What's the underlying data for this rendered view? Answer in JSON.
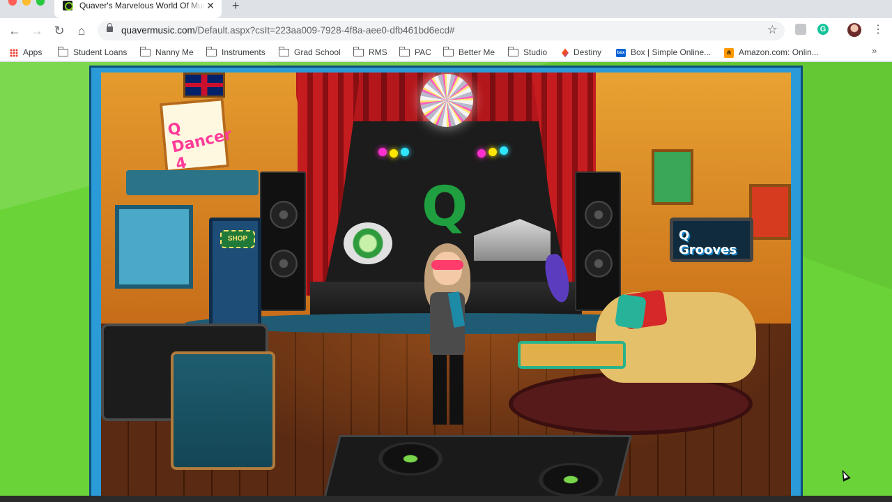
{
  "window": {
    "tab_title": "Quaver's Marvelous World Of Music",
    "tab_close_glyph": "✕",
    "new_tab_glyph": "+",
    "favicon": "quaver-q-icon"
  },
  "toolbar": {
    "back_glyph": "←",
    "forward_glyph": "→",
    "reload_glyph": "↻",
    "home_glyph": "⌂",
    "url_host": "quavermusic.com",
    "url_path": "/Default.aspx?csIt=223aa009-7928-4f8a-aee0-dfb461bd6ecd#",
    "star_glyph": "☆",
    "grammarly_letter": "G",
    "menu_glyph": "⋮"
  },
  "bookmarks": {
    "items": [
      {
        "label": "Apps",
        "icon": "apps-grid-icon"
      },
      {
        "label": "Student Loans",
        "icon": "folder-icon"
      },
      {
        "label": "Nanny Me",
        "icon": "folder-icon"
      },
      {
        "label": "Instruments",
        "icon": "folder-icon"
      },
      {
        "label": "Grad School",
        "icon": "folder-icon"
      },
      {
        "label": "RMS",
        "icon": "folder-icon"
      },
      {
        "label": "PAC",
        "icon": "folder-icon"
      },
      {
        "label": "Better Me",
        "icon": "folder-icon"
      },
      {
        "label": "Studio",
        "icon": "folder-icon"
      },
      {
        "label": "Destiny",
        "icon": "destiny-icon"
      },
      {
        "label": "Box | Simple Online...",
        "icon": "box-icon"
      },
      {
        "label": "Amazon.com: Onlin...",
        "icon": "amazon-icon"
      }
    ],
    "overflow_glyph": "»",
    "box_icon_text": "box",
    "amazon_icon_text": "a"
  },
  "scene": {
    "dancer_sign": "Q Dancer 4",
    "shop_sign": "SHOP",
    "grooves_sign": "Q Grooves",
    "stage_logo": "Q"
  },
  "colors": {
    "page_background": "#69d337",
    "frame_border": "#2a9bd6",
    "accent_green": "#1f9f3f"
  }
}
